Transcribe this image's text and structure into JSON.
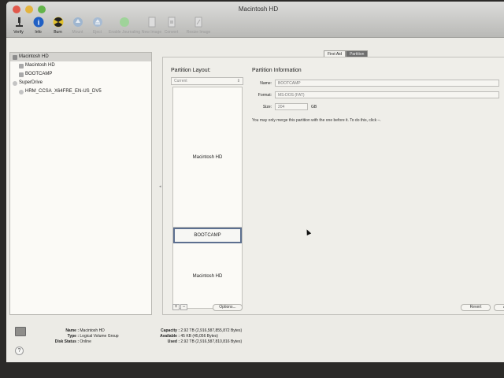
{
  "window": {
    "title": "Macintosh HD"
  },
  "toolbar": {
    "items": [
      {
        "label": "Verify",
        "icon": "microscope-icon",
        "enabled": true
      },
      {
        "label": "Info",
        "icon": "info-icon",
        "enabled": true
      },
      {
        "label": "Burn",
        "icon": "burn-icon",
        "enabled": true
      },
      {
        "label": "Mount",
        "icon": "mount-icon",
        "enabled": false
      },
      {
        "label": "Eject",
        "icon": "eject-icon",
        "enabled": false
      },
      {
        "label": "Enable Journaling",
        "icon": "journaling-icon",
        "enabled": false
      },
      {
        "label": "New Image",
        "icon": "new-image-icon",
        "enabled": false
      },
      {
        "label": "Convert",
        "icon": "convert-icon",
        "enabled": false
      },
      {
        "label": "Resize Image",
        "icon": "resize-image-icon",
        "enabled": false
      }
    ]
  },
  "sidebar": {
    "items": [
      {
        "label": "Macintosh HD",
        "level": 0,
        "selected": true
      },
      {
        "label": "Macintosh HD",
        "level": 1
      },
      {
        "label": "BOOTCAMP",
        "level": 1
      },
      {
        "label": "SuperDrive",
        "level": 0
      },
      {
        "label": "HRM_CCSA_X64FRE_EN-US_DV5",
        "level": 1
      }
    ]
  },
  "tabs": {
    "first_aid": "First Aid",
    "partition": "Partition"
  },
  "partition_layout": {
    "title": "Partition Layout:",
    "select_value": "Current",
    "segments": [
      {
        "label": "Macintosh HD"
      },
      {
        "label": "BOOTCAMP",
        "selected": true
      },
      {
        "label": "Macintosh HD"
      }
    ],
    "add_label": "+",
    "remove_label": "−",
    "options_label": "Options..."
  },
  "partition_info": {
    "title": "Partition Information",
    "name_label": "Name:",
    "name_value": "BOOTCAMP",
    "format_label": "Format:",
    "format_value": "MS-DOS (FAT)",
    "size_label": "Size:",
    "size_value": "204",
    "size_unit": "GB",
    "message": "You may only merge this partition with the one before it. To do this, click –."
  },
  "buttons": {
    "revert": "Revert",
    "apply": "Ap"
  },
  "disk_info": {
    "name_label": "Name :",
    "name_value": "Macintosh HD",
    "type_label": "Type :",
    "type_value": "Logical Volume Group",
    "status_label": "Disk Status :",
    "status_value": "Online",
    "capacity_label": "Capacity :",
    "capacity_value": "2.92 TB (2,916,587,855,872 Bytes)",
    "available_label": "Available :",
    "available_value": "45 KB (45,056 Bytes)",
    "used_label": "Used :",
    "used_value": "2.92 TB (2,916,587,810,816 Bytes)"
  },
  "help": "?"
}
